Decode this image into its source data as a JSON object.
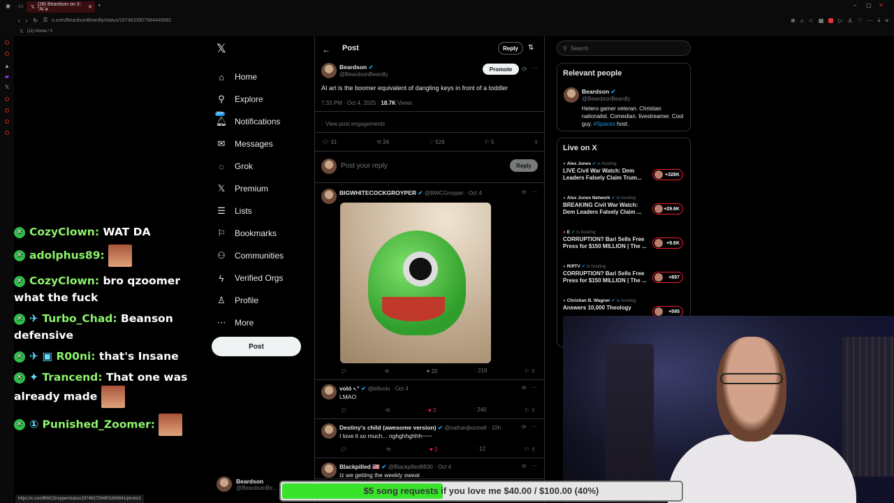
{
  "browser": {
    "tab_title": "(28) Beardson on X: \"AI a",
    "url": "x.com/BeardsonBeardly/status/1974633907984445882",
    "bookmark": "(11) Home / X",
    "status_url": "https://x.com/BWCGroyper/status/1974637294901690641/photo/1"
  },
  "chat": [
    {
      "user": "CozyClown:",
      "text": "WAT DA",
      "icons": [],
      "emote": false
    },
    {
      "user": "adolphus89:",
      "text": "",
      "icons": [],
      "emote": true
    },
    {
      "user": "CozyClown:",
      "text": "bro qzoomer what the fuck",
      "icons": [],
      "emote": false
    },
    {
      "user": "Turbo_Chad:",
      "text": "Beanson defensive",
      "icons": [
        "✈"
      ],
      "emote": false
    },
    {
      "user": "R00ni:",
      "text": "that's Insane",
      "icons": [
        "✈",
        "▣"
      ],
      "emote": false
    },
    {
      "user": "Trancend:",
      "text": "That one was already made",
      "icons": [
        "✦"
      ],
      "emote": true
    },
    {
      "user": "Punished_Zoomer:",
      "text": "",
      "icons": [
        "①"
      ],
      "emote": true
    }
  ],
  "nav": {
    "items": [
      {
        "icon": "home-icon",
        "glyph": "⌂",
        "label": "Home"
      },
      {
        "icon": "search-icon",
        "glyph": "⚲",
        "label": "Explore"
      },
      {
        "icon": "bell-icon",
        "glyph": "🔔︎",
        "label": "Notifications",
        "badge": "20+"
      },
      {
        "icon": "mail-icon",
        "glyph": "✉",
        "label": "Messages"
      },
      {
        "icon": "grok-icon",
        "glyph": "◌",
        "label": "Grok"
      },
      {
        "icon": "x-logo-icon",
        "glyph": "𝕏",
        "label": "Premium"
      },
      {
        "icon": "list-icon",
        "glyph": "☰",
        "label": "Lists"
      },
      {
        "icon": "bookmark-icon",
        "glyph": "⚐",
        "label": "Bookmarks"
      },
      {
        "icon": "communities-icon",
        "glyph": "⚇",
        "label": "Communities"
      },
      {
        "icon": "lightning-icon",
        "glyph": "ϟ",
        "label": "Verified Orgs"
      },
      {
        "icon": "person-icon",
        "glyph": "♙",
        "label": "Profile"
      },
      {
        "icon": "more-icon",
        "glyph": "⋯",
        "label": "More"
      }
    ],
    "post_label": "Post",
    "account_name": "Beardson",
    "account_handle": "@BeardsonBe..."
  },
  "post": {
    "header": "Post",
    "reply_btn": "Reply",
    "author": "Beardson",
    "handle": "@BeardsonBeardly",
    "promote": "Promote",
    "text": "AI art is the boomer equivalent of dangling keys in front of a toddler",
    "time": "7:33 PM · Oct 4, 2025 · ",
    "views": "18.7K",
    "views_label": "Views",
    "engagements": "View post engagements",
    "replies": "31",
    "reposts": "24",
    "likes": "526",
    "bookmarks": "5",
    "reply_placeholder": "Post your reply",
    "reply_submit": "Reply"
  },
  "replies": [
    {
      "name": "BIGWHITECOCKGROYPER",
      "handle": "@BWCGroyper · Oct 4",
      "text": "",
      "likes": "20",
      "views": "219",
      "has_image": true
    },
    {
      "name": "voló •.°",
      "handle": "@killvolo · Oct 4",
      "text": "LMAO",
      "likes": "3",
      "views": "240",
      "has_image": false
    },
    {
      "name": "Destiny's child (awesome version)",
      "handle": "@nathanjbonnell · 10h",
      "text": "I love it so much... nghghhghhh~~~",
      "likes": "2",
      "views": "12",
      "has_image": false
    },
    {
      "name": "Blackpilled 🇺🇸",
      "handle": "@Blackpilled8930 · Oct 4",
      "text": "Iz we getting the weekly sweat",
      "likes": "",
      "views": "",
      "has_image": false
    }
  ],
  "right": {
    "search_placeholder": "Search",
    "relevant_title": "Relevant people",
    "person_name": "Beardson",
    "person_handle": "@BeardsonBeardly",
    "bio": "Hetero gamer veteran. Christian nationalist. Comedian. livestreamer. Cool guy. ",
    "bio_tag": "#Spaces",
    "bio_end": " host.",
    "live_title": "Live on X",
    "live": [
      {
        "host": "Alex Jones",
        "status": "is hosting",
        "title": "LIVE Civil War Watch: Dem Leaders Falsely Claim Trum...",
        "count": "+328K"
      },
      {
        "host": "Alex Jones Network",
        "status": "is hosting",
        "title": "BREAKING Civil War Watch: Dem Leaders Falsely Claim ...",
        "count": "+29.6K"
      },
      {
        "host": "E",
        "status": "is hosting",
        "title": "CORRUPTION? Bari Sells Free Press for $150 MILLION | The ...",
        "count": "+9.6K"
      },
      {
        "host": "RiffTV",
        "status": "is hosting",
        "title": "CORRUPTION? Bari Sells Free Press for $150 MILLION | The ...",
        "count": "+897"
      },
      {
        "host": "Christian B. Wagner",
        "status": "is hosting",
        "title": "Answers 10,000 Theology",
        "count": "+595"
      }
    ]
  },
  "donation": {
    "label": "$5 song requests if you love me $40.00 / $100.00 (40%)",
    "progress": 0.4
  },
  "colors": {
    "accent": "#1d9bf0",
    "chat_user": "#8ef36e",
    "like": "#f91880",
    "bar": "#39e22b"
  }
}
